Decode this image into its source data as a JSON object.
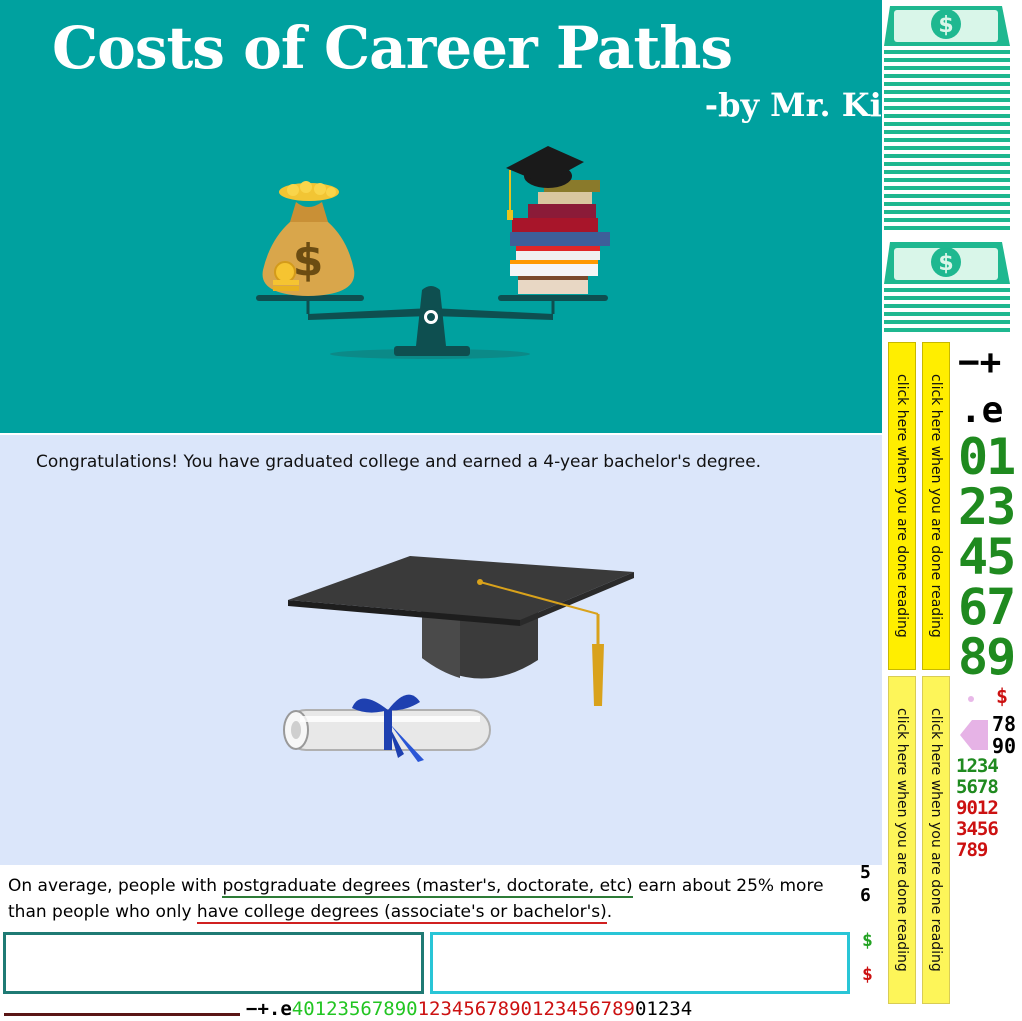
{
  "banner": {
    "title": "Costs of Career Paths",
    "byline": "-by Mr. Kimmel",
    "background": "#00a19f"
  },
  "story": {
    "intro": "Congratulations! You have graduated college and earned a 4-year bachelor's degree.",
    "background": "#dbe6fa"
  },
  "fact": {
    "part1": "On average, people with ",
    "link_postgrad": "postgraduate degrees (master's, doctorate, etc)",
    "part2": " earn about 25% more than people who only ",
    "link_college": "have college degrees (associate's or bachelor's)",
    "part3": "."
  },
  "side_digits": {
    "top1": "5",
    "top2": "6",
    "green_dollar": "$",
    "red_dollar": "$"
  },
  "done_button_label": "click here when you are done reading",
  "palette": {
    "minus_plus": "−+",
    "dot_e": ".e",
    "big_rows": [
      "01",
      "23",
      "45",
      "67",
      "89"
    ],
    "red_dollar": "$",
    "row_78": "78",
    "row_90": "90",
    "green_rows": [
      "1234",
      "5678"
    ],
    "red_rows": [
      "9012",
      "3456",
      "789"
    ]
  },
  "strip": {
    "prefix": "−+.e",
    "green": "40123567890",
    "red": "1234567890123456789",
    "black": "01234"
  },
  "colors": {
    "money_green": "#1fb890",
    "button_yellow": "#ffee00",
    "digit_green": "#1f8a1f",
    "digit_red": "#cc1111"
  }
}
